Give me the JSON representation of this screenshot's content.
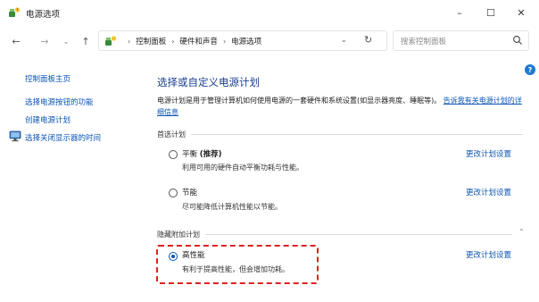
{
  "window": {
    "title": "电源选项",
    "minimize_glyph": "–",
    "maximize_glyph": "☐",
    "close_glyph": "✕"
  },
  "nav": {
    "back_glyph": "←",
    "forward_glyph": "→",
    "recent_glyph": "⌄",
    "up_glyph": "↑",
    "breadcrumb": [
      "控制面板",
      "硬件和声音",
      "电源选项"
    ],
    "breadcrumb_separator": "›",
    "dropdown_glyph": "⌄",
    "refresh_glyph": "↻",
    "search_placeholder": "搜索控制面板"
  },
  "left_pane": {
    "home": "控制面板主页",
    "items": [
      "选择电源按钮的功能",
      "创建电源计划",
      "选择关闭显示器的时间"
    ]
  },
  "help_glyph": "?",
  "main": {
    "title": "选择或自定义电源计划",
    "description": "电源计划是用于管理计算机如何使用电源的一套硬件和系统设置(如显示器亮度、睡眠等)。",
    "description_link": "告诉我有关电源计划的详细信息",
    "preferred_group": "首选计划",
    "hidden_group": "隐藏附加计划",
    "collapse_glyph": "⌃",
    "plans": [
      {
        "name": "平衡",
        "tag": "(推荐)",
        "desc": "利用可用的硬件自动平衡功耗与性能。",
        "link": "更改计划设置",
        "selected": false
      },
      {
        "name": "节能",
        "tag": "",
        "desc": "尽可能降低计算机性能以节能。",
        "link": "更改计划设置",
        "selected": false
      },
      {
        "name": "高性能",
        "tag": "",
        "desc": "有利于提高性能，但会增加功耗。",
        "link": "更改计划设置",
        "selected": true
      }
    ]
  },
  "colors": {
    "link": "#0b55b3",
    "title": "#1a3f8f",
    "highlight_dash": "#e02020"
  },
  "icons": {
    "app": "power-options-icon",
    "address": "control-panel-icon",
    "search": "search-icon",
    "display_off": "monitor-icon"
  }
}
